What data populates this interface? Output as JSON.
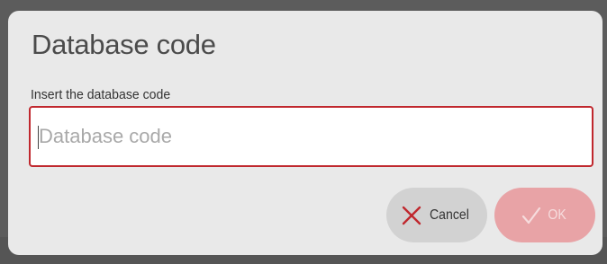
{
  "dialog": {
    "title": "Database code",
    "field_label": "Insert the database code",
    "input": {
      "value": "",
      "placeholder": "Database code"
    },
    "buttons": {
      "cancel_label": "Cancel",
      "ok_label": "OK"
    }
  },
  "colors": {
    "accent": "#c0282e",
    "ok_disabled": "#e8a3a6",
    "cancel_bg": "#d2d2d2",
    "dialog_bg": "#e9e9e9",
    "backdrop": "#5c5c5c"
  },
  "icons": {
    "cancel": "close-icon",
    "ok": "check-icon"
  }
}
